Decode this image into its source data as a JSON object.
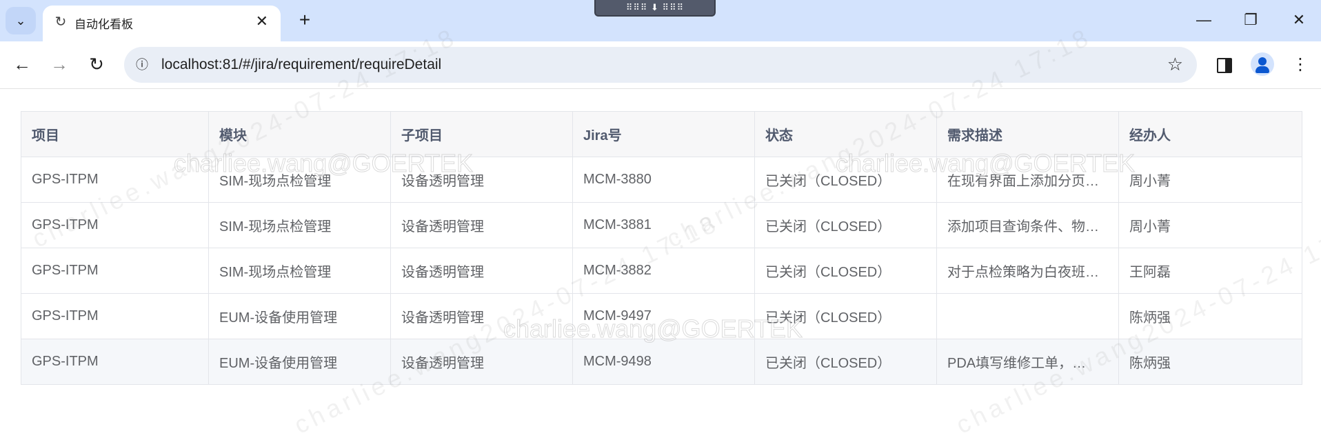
{
  "browser": {
    "tab_search_icon": "chevron-down-icon",
    "tab": {
      "favicon": "loading-icon",
      "title": "自动化看板",
      "close_glyph": "✕"
    },
    "new_tab_glyph": "+",
    "extension_handle_text": "⠿⠿⠿ ⬇ ⠿⠿⠿",
    "window_controls": {
      "minimize": "—",
      "restore": "❐",
      "close": "✕"
    },
    "nav": {
      "back": "←",
      "forward": "→",
      "reload": "↻"
    },
    "address": {
      "url": "localhost:81/#/jira/requirement/requireDetail",
      "site_info_glyph": "ⓘ",
      "bookmark_glyph": "☆"
    },
    "menu_glyph": "⋮"
  },
  "table": {
    "columns": [
      "项目",
      "模块",
      "子项目",
      "Jira号",
      "状态",
      "需求描述",
      "经办人"
    ],
    "rows": [
      [
        "GPS-ITPM",
        "SIM-现场点检管理",
        "设备透明管理",
        "MCM-3880",
        "已关闭（CLOSED）",
        "在现有界面上添加分页…",
        "周小菁"
      ],
      [
        "GPS-ITPM",
        "SIM-现场点检管理",
        "设备透明管理",
        "MCM-3881",
        "已关闭（CLOSED）",
        "添加项目查询条件、物…",
        "周小菁"
      ],
      [
        "GPS-ITPM",
        "SIM-现场点检管理",
        "设备透明管理",
        "MCM-3882",
        "已关闭（CLOSED）",
        "对于点检策略为白夜班…",
        "王阿磊"
      ],
      [
        "GPS-ITPM",
        "EUM-设备使用管理",
        "设备透明管理",
        "MCM-9497",
        "已关闭（CLOSED）",
        "",
        "陈炳强"
      ],
      [
        "GPS-ITPM",
        "EUM-设备使用管理",
        "设备透明管理",
        "MCM-9498",
        "已关闭（CLOSED）",
        "PDA填写维修工单，…",
        "陈炳强"
      ]
    ]
  },
  "watermark": {
    "email": "charliee.wang@GOERTEK",
    "diagonal_text": "charliee.wang2024-07-24 17:18"
  },
  "colors": {
    "tabstrip": "#d3e3fd",
    "omnibox": "#e9eef6",
    "header_bg": "#f7f7f8",
    "hover_row": "#f5f7fa"
  }
}
